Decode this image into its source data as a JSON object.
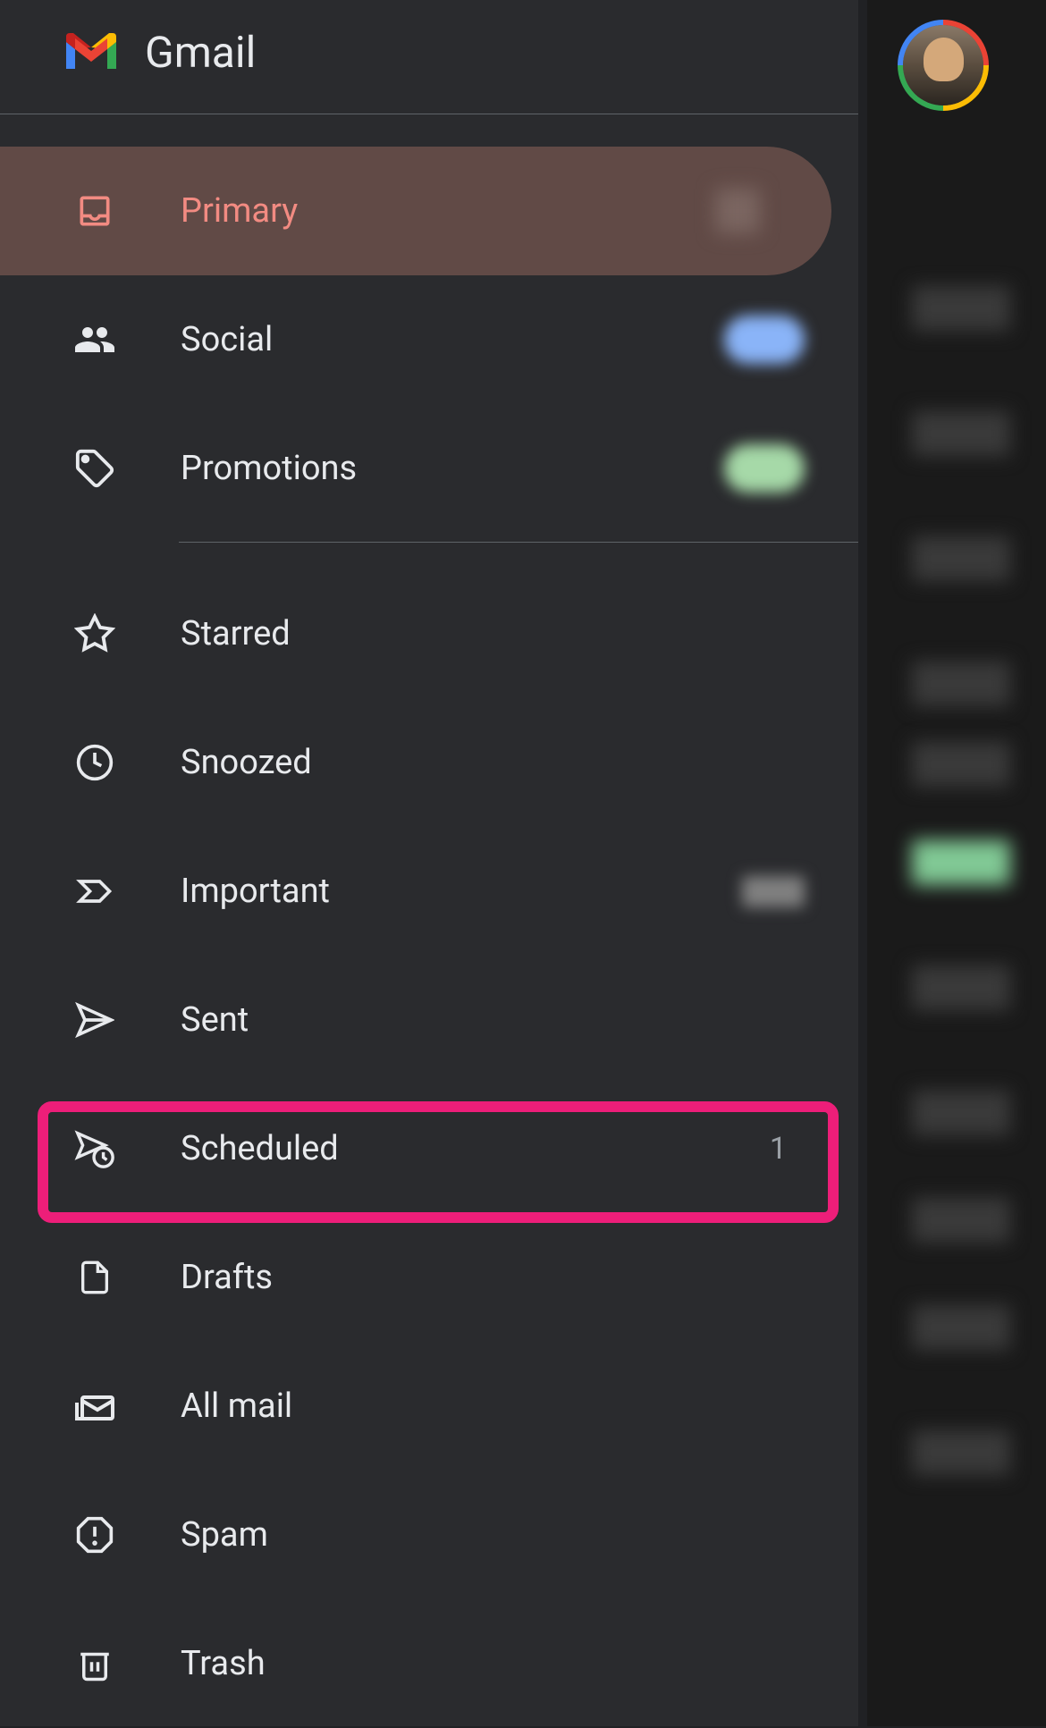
{
  "app_title": "Gmail",
  "nav": {
    "primary": {
      "label": "Primary"
    },
    "social": {
      "label": "Social"
    },
    "promotions": {
      "label": "Promotions"
    },
    "starred": {
      "label": "Starred"
    },
    "snoozed": {
      "label": "Snoozed"
    },
    "important": {
      "label": "Important"
    },
    "sent": {
      "label": "Sent"
    },
    "scheduled": {
      "label": "Scheduled",
      "count": "1"
    },
    "drafts": {
      "label": "Drafts"
    },
    "all_mail": {
      "label": "All mail"
    },
    "spam": {
      "label": "Spam"
    },
    "trash": {
      "label": "Trash"
    }
  },
  "highlight": {
    "target": "scheduled",
    "color": "#ed1e79"
  }
}
